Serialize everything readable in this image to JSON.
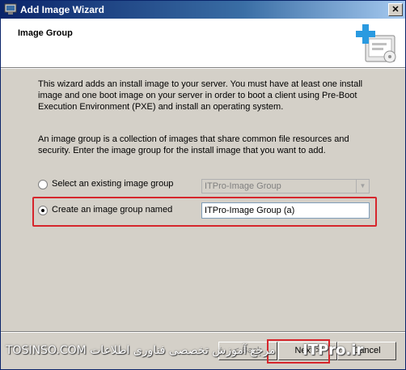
{
  "window": {
    "title": "Add Image Wizard",
    "close_glyph": "✕",
    "icon": "wizard-window-icon"
  },
  "header": {
    "title": "Image Group",
    "icon": "add-image-icon"
  },
  "body": {
    "paragraph1": "This wizard adds an install image to your server. You must have at least one install image and one boot image on your server in order to boot a client using Pre-Boot Execution Environment (PXE) and install an operating system.",
    "paragraph2": "An image group is a collection of images that share common file resources and security. Enter the image group for the install image that you want to add."
  },
  "options": {
    "existing": {
      "label": "Select an existing image group",
      "selected": false,
      "value": "ITPro-Image Group"
    },
    "create": {
      "label": "Create an image group named",
      "selected": true,
      "value": "ITPro-Image Group (a)"
    }
  },
  "buttons": {
    "back": "< Back",
    "next": "Next >",
    "cancel": "Cancel"
  },
  "watermark": {
    "text": "TOSINSO.COM  مرجع آموزش تخصصی فناوری اطلاعات",
    "brand": "ITPro.ir"
  },
  "colors": {
    "highlight": "#d6262c",
    "titlebar_start": "#0a246a",
    "titlebar_end": "#a6caf0"
  }
}
